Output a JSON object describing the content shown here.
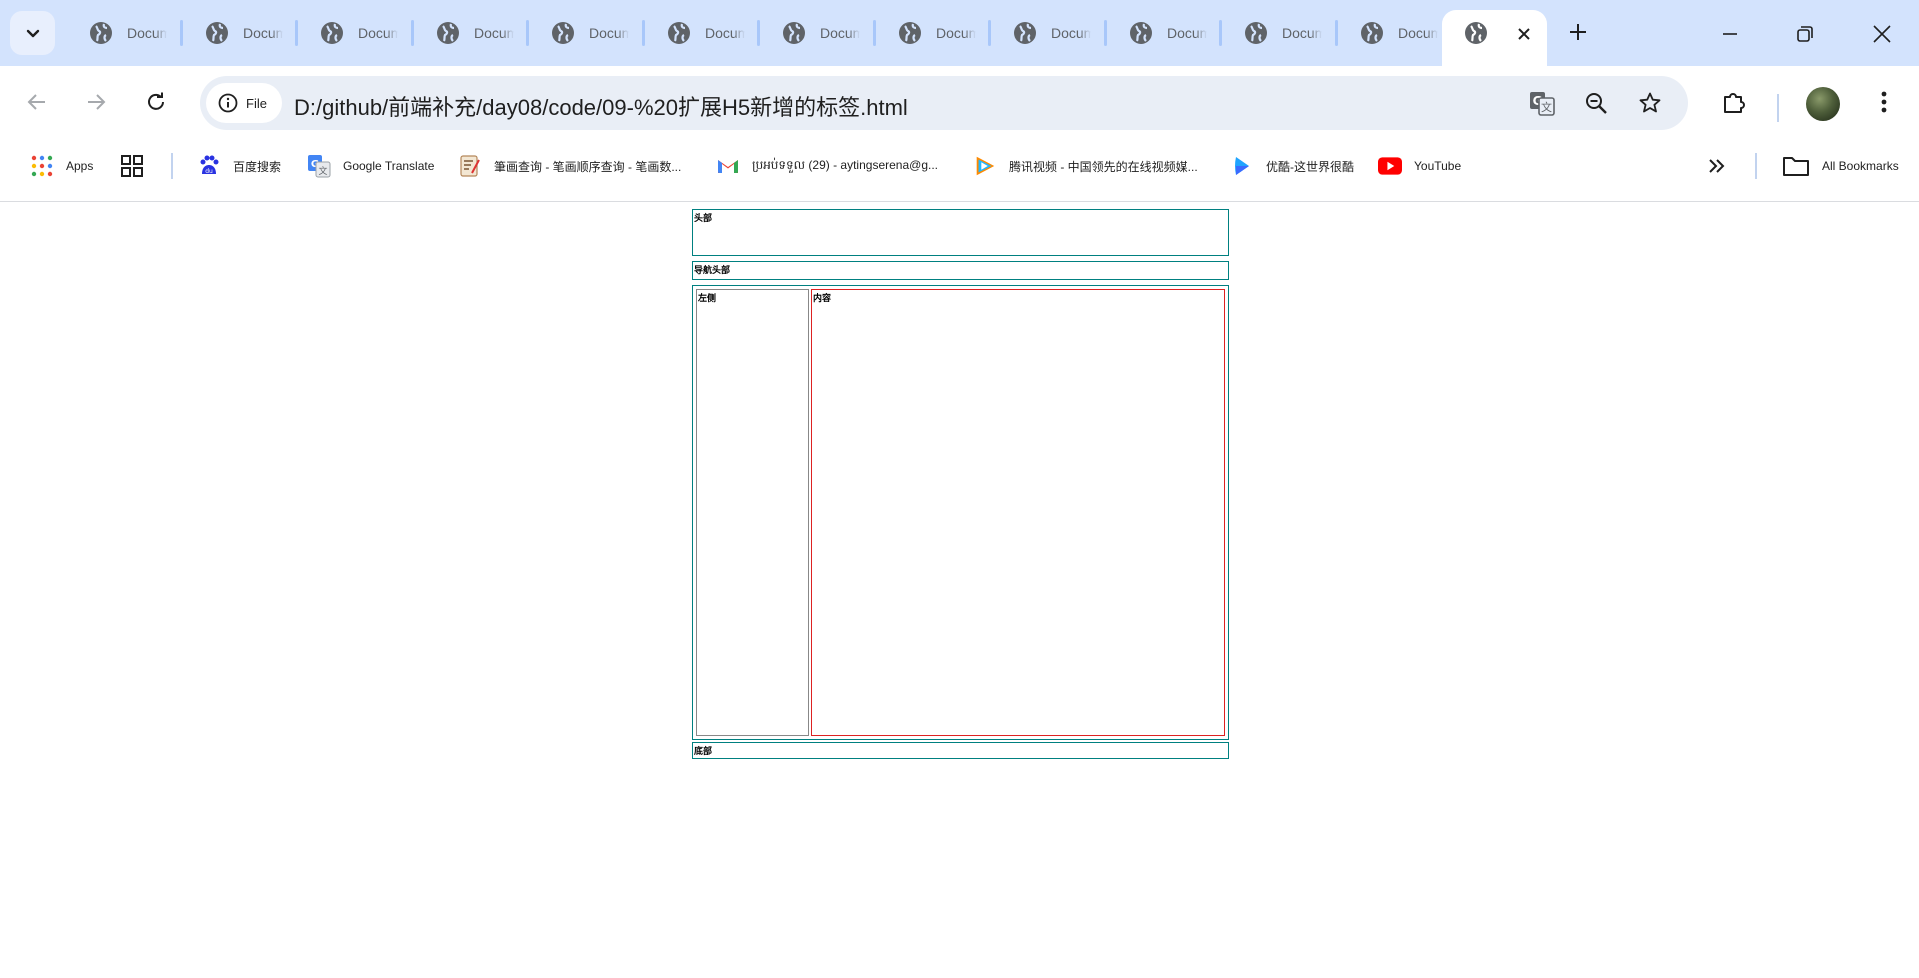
{
  "browser": {
    "tabs": [
      {
        "title": "Docum"
      },
      {
        "title": "Docum"
      },
      {
        "title": "Docum"
      },
      {
        "title": "Docum"
      },
      {
        "title": "Docum"
      },
      {
        "title": "Docum"
      },
      {
        "title": "Docum"
      },
      {
        "title": "Docum"
      },
      {
        "title": "Docum"
      },
      {
        "title": "Docum"
      },
      {
        "title": "Docum"
      },
      {
        "title": "Docum"
      }
    ],
    "address": {
      "chip_label": "File",
      "url": "D:/github/前端补充/day08/code/09-%20扩展H5新增的标签.html"
    },
    "bookmarks": [
      {
        "label": "Apps",
        "icon": "apps-grid-icon"
      },
      {
        "label": "百度搜索",
        "icon": "baidu-icon"
      },
      {
        "label": "Google Translate",
        "icon": "google-translate-icon"
      },
      {
        "label": "筆画查询 - 笔画顺序查询 - 笔画数...",
        "icon": "bihua-icon"
      },
      {
        "label": "ប្រអប់ទទួល (29) - aytingserena@g...",
        "icon": "gmail-icon"
      },
      {
        "label": "腾讯视频 - 中国领先的在线视频媒...",
        "icon": "tencent-video-icon"
      },
      {
        "label": "优酷-这世界很酷",
        "icon": "youku-icon"
      },
      {
        "label": "YouTube",
        "icon": "youtube-icon"
      }
    ],
    "all_bookmarks_label": "All Bookmarks"
  },
  "page": {
    "header": "头部",
    "nav": "导航头部",
    "aside": "左侧",
    "article": "内容",
    "footer": "底部"
  },
  "colors": {
    "tabstrip_bg": "#d3e3fd",
    "omnibox_bg": "#e9eef6",
    "section_border": "#008080",
    "content_border": "#dd2222"
  }
}
